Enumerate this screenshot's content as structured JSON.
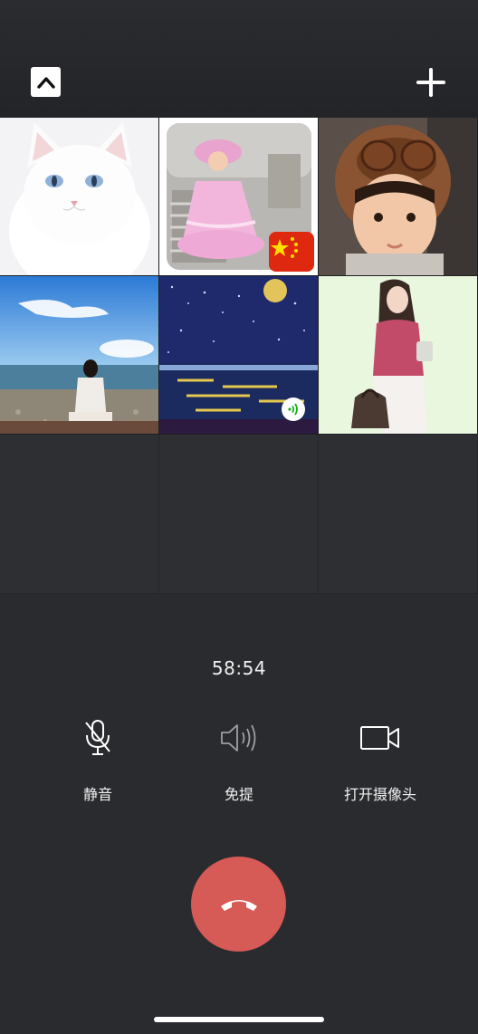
{
  "call": {
    "timer": "58:54"
  },
  "controls": [
    {
      "label": "静音",
      "icon": "microphone-icon"
    },
    {
      "label": "免提",
      "icon": "speaker-icon"
    },
    {
      "label": "打开摄像头",
      "icon": "video-camera-icon"
    }
  ],
  "participants": [
    {
      "avatar": "white-cat",
      "badge": null
    },
    {
      "avatar": "girl-pink-dress",
      "badge": "china-flag"
    },
    {
      "avatar": "child-aviator-hat",
      "badge": null
    },
    {
      "avatar": "woman-on-beach",
      "badge": null
    },
    {
      "avatar": "night-sea-painting",
      "badge": "speaking-indicator"
    },
    {
      "avatar": "woman-illustration",
      "badge": null
    }
  ],
  "colors": {
    "background": "#2a2b2f",
    "hangup": "#d65a55",
    "tile_empty": "#2e2f33"
  }
}
